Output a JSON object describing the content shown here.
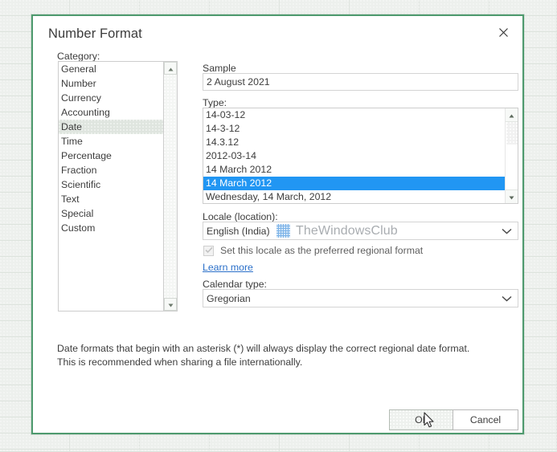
{
  "dialog": {
    "title": "Number Format",
    "close_icon": "close-icon"
  },
  "category": {
    "label": "Category:",
    "items": [
      "General",
      "Number",
      "Currency",
      "Accounting",
      "Date",
      "Time",
      "Percentage",
      "Fraction",
      "Scientific",
      "Text",
      "Special",
      "Custom"
    ],
    "selected": "Date",
    "selected_index": 4,
    "scroll_up_icon": "scroll-up-arrow-icon",
    "scroll_down_icon": "scroll-down-arrow-icon"
  },
  "sample": {
    "label": "Sample",
    "value": "2 August 2021"
  },
  "type": {
    "label": "Type:",
    "items": [
      "14-03-12",
      "14-3-12",
      "14.3.12",
      "2012-03-14",
      "14 March 2012",
      "14 March 2012",
      "Wednesday, 14 March, 2012"
    ],
    "selected": "14 March 2012",
    "selected_index": 5,
    "scroll_up_icon": "scroll-up-arrow-icon",
    "scroll_down_icon": "scroll-down-arrow-icon"
  },
  "locale": {
    "label": "Locale (location):",
    "value": "English (India)",
    "chevron_icon": "chevron-down-icon"
  },
  "watermark": {
    "text": "TheWindowsClub",
    "logo_icon": "windows-club-logo-icon"
  },
  "preferred_locale": {
    "label": "Set this locale as the preferred regional format",
    "checked": true,
    "disabled": true,
    "check_icon": "checkmark-icon"
  },
  "learn_more": {
    "label": "Learn more"
  },
  "calendar": {
    "label": "Calendar type:",
    "value": "Gregorian",
    "chevron_icon": "chevron-down-icon"
  },
  "description": {
    "line1": "Date formats that begin with an asterisk (*) will always display the correct regional date format.",
    "line2": "This is recommended when sharing a file internationally."
  },
  "buttons": {
    "ok": "OK",
    "cancel": "Cancel"
  },
  "cursor": {
    "icon": "mouse-pointer-icon"
  },
  "colors": {
    "dialog_border": "#4e9a6e",
    "selection_blue": "#2196f3",
    "link_blue": "#2a6fc9",
    "category_selection": "#dfe5df",
    "sheet_background": "#edf0ed"
  }
}
